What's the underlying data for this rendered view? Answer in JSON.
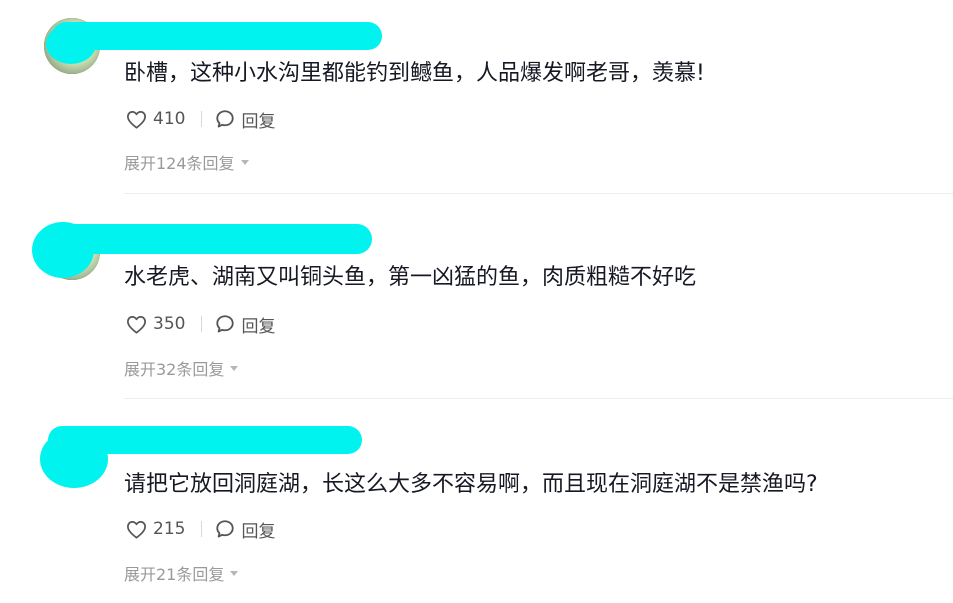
{
  "comments": [
    {
      "text": "卧槽，这种小水沟里都能钓到鳡鱼，人品爆发啊老哥，羡慕!",
      "likes": "410",
      "reply_label": "回复",
      "expand_label": "展开124条回复"
    },
    {
      "text": "水老虎、湖南又叫铜头鱼，第一凶猛的鱼，肉质粗糙不好吃",
      "likes": "350",
      "reply_label": "回复",
      "expand_label": "展开32条回复"
    },
    {
      "text": "请把它放回洞庭湖，长这么大多不容易啊，而且现在洞庭湖不是禁渔吗?",
      "likes": "215",
      "reply_label": "回复",
      "expand_label": "展开21条回复"
    }
  ],
  "colors": {
    "redaction": "#00f3ee",
    "muted_text": "#9a9a9a",
    "body_text": "#161823"
  },
  "icons": {
    "like": "heart-outline-icon",
    "reply": "speech-bubble-icon",
    "expand": "caret-down-icon"
  }
}
